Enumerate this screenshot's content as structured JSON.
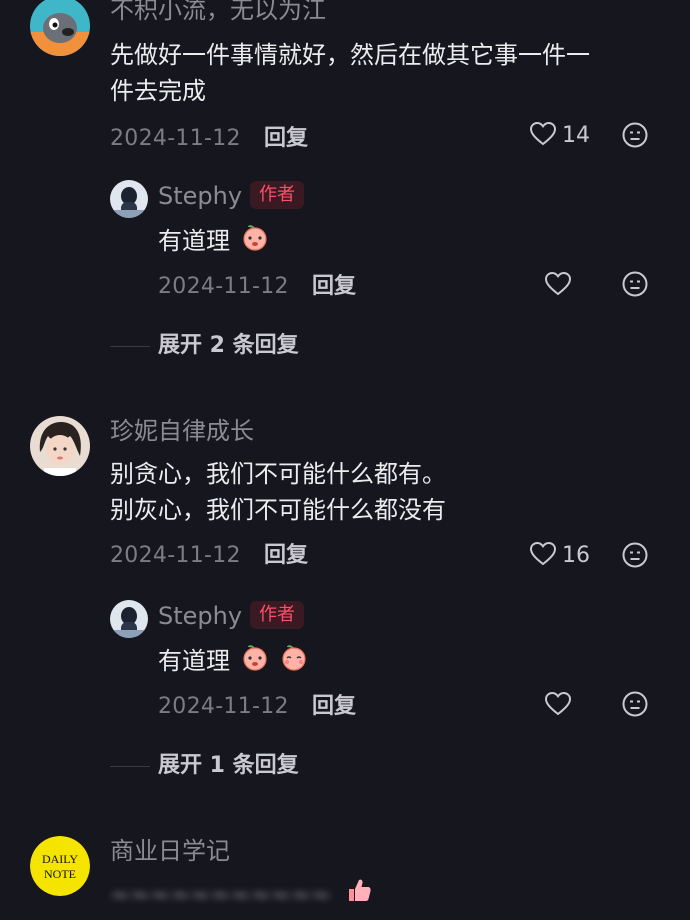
{
  "comments": [
    {
      "username": "不积小流，无以为江",
      "text_lines": [
        "先做好一件事情就好，然后在做其它事一件一",
        "件去完成"
      ],
      "date": "2024-11-12",
      "reply_label": "回复",
      "likes": "14",
      "author_reply": {
        "username": "Stephy",
        "tag": "作者",
        "text": "有道理",
        "date": "2024-11-12",
        "reply_label": "回复"
      },
      "expand_label": "展开 2 条回复"
    },
    {
      "username": "珍妮自律成长",
      "text_lines": [
        "别贪心，我们不可能什么都有。",
        "别灰心，我们不可能什么都没有"
      ],
      "date": "2024-11-12",
      "reply_label": "回复",
      "likes": "16",
      "author_reply": {
        "username": "Stephy",
        "tag": "作者",
        "text": "有道理",
        "date": "2024-11-12",
        "reply_label": "回复"
      },
      "expand_label": "展开 1 条回复"
    },
    {
      "username": "商业日学记",
      "avatar_text_line1": "DAILY",
      "avatar_text_line2": "NOTE",
      "blurred_text": "~~~~~~~~~~~"
    }
  ],
  "colors": {
    "background": "#16161e",
    "author_tag_text": "#ff4d6a",
    "author_tag_bg": "#3a1a22",
    "daily_note_yellow": "#f5e400"
  },
  "icons": [
    "heart-icon",
    "dislike-face-icon",
    "peach-emoji",
    "thumbs-up-emoji"
  ]
}
